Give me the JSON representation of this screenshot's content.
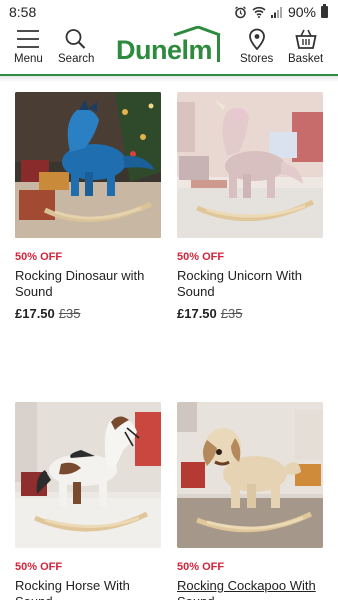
{
  "status": {
    "time": "8:58",
    "battery": "90%"
  },
  "header": {
    "menu_label": "Menu",
    "search_label": "Search",
    "logo_text": "Dunelm",
    "stores_label": "Stores",
    "basket_label": "Basket",
    "brand_color": "#2d8a3e"
  },
  "products": [
    {
      "badge": "50% OFF",
      "title": "Rocking Dinosaur with Sound",
      "price": "£17.50",
      "was_price": "£35"
    },
    {
      "badge": "50% OFF",
      "title": "Rocking Unicorn With Sound",
      "price": "£17.50",
      "was_price": "£35"
    },
    {
      "badge": "50% OFF",
      "title": "Rocking Horse With Sound"
    },
    {
      "badge": "50% OFF",
      "title": "Rocking Cockapoo With Sound"
    }
  ]
}
